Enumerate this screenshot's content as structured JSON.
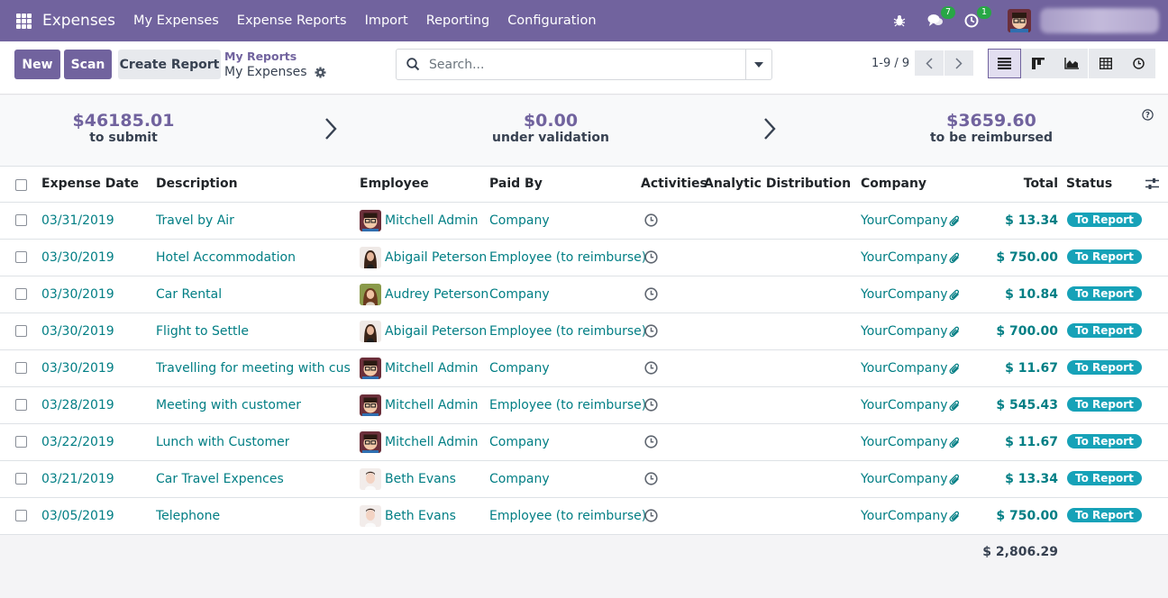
{
  "nav": {
    "app_name": "Expenses",
    "menu": [
      "My Expenses",
      "Expense Reports",
      "Import",
      "Reporting",
      "Configuration"
    ],
    "messages_count": "7",
    "activities_count": "1"
  },
  "control": {
    "new_label": "New",
    "scan_label": "Scan",
    "create_report_label": "Create Report",
    "breadcrumb_parent": "My Reports",
    "breadcrumb_current": "My Expenses",
    "search_placeholder": "Search...",
    "pager": "1-9 / 9"
  },
  "summary": {
    "to_submit_amount": "$46185.01",
    "to_submit_label": "to submit",
    "validation_amount": "$0.00",
    "validation_label": "under validation",
    "reimbursed_amount": "$3659.60",
    "reimbursed_label": "to be reimbursed"
  },
  "table": {
    "columns": {
      "date": "Expense Date",
      "description": "Description",
      "employee": "Employee",
      "paid_by": "Paid By",
      "activities": "Activities",
      "analytic": "Analytic Distribution",
      "company": "Company",
      "total": "Total",
      "status": "Status"
    },
    "rows": [
      {
        "date": "03/31/2019",
        "description": "Travel by Air",
        "employee": "Mitchell Admin",
        "avatar": "mitchell",
        "paid_by": "Company",
        "company": "YourCompany",
        "total": "$ 13.34",
        "status": "To Report"
      },
      {
        "date": "03/30/2019",
        "description": "Hotel Accommodation",
        "employee": "Abigail Peterson",
        "avatar": "abigail",
        "paid_by": "Employee (to reimburse)",
        "company": "YourCompany",
        "total": "$ 750.00",
        "status": "To Report"
      },
      {
        "date": "03/30/2019",
        "description": "Car Rental",
        "employee": "Audrey Peterson",
        "avatar": "audrey",
        "paid_by": "Company",
        "company": "YourCompany",
        "total": "$ 10.84",
        "status": "To Report"
      },
      {
        "date": "03/30/2019",
        "description": "Flight to Settle",
        "employee": "Abigail Peterson",
        "avatar": "abigail",
        "paid_by": "Employee (to reimburse)",
        "company": "YourCompany",
        "total": "$ 700.00",
        "status": "To Report"
      },
      {
        "date": "03/30/2019",
        "description": "Travelling for meeting with cust…",
        "employee": "Mitchell Admin",
        "avatar": "mitchell",
        "paid_by": "Company",
        "company": "YourCompany",
        "total": "$ 11.67",
        "status": "To Report"
      },
      {
        "date": "03/28/2019",
        "description": "Meeting with customer",
        "employee": "Mitchell Admin",
        "avatar": "mitchell",
        "paid_by": "Employee (to reimburse)",
        "company": "YourCompany",
        "total": "$ 545.43",
        "status": "To Report"
      },
      {
        "date": "03/22/2019",
        "description": "Lunch with Customer",
        "employee": "Mitchell Admin",
        "avatar": "mitchell",
        "paid_by": "Company",
        "company": "YourCompany",
        "total": "$ 11.67",
        "status": "To Report"
      },
      {
        "date": "03/21/2019",
        "description": "Car Travel Expences",
        "employee": "Beth Evans",
        "avatar": "beth",
        "paid_by": "Company",
        "company": "YourCompany",
        "total": "$ 13.34",
        "status": "To Report"
      },
      {
        "date": "03/05/2019",
        "description": "Telephone",
        "employee": "Beth Evans",
        "avatar": "beth",
        "paid_by": "Employee (to reimburse)",
        "company": "YourCompany",
        "total": "$ 750.00",
        "status": "To Report"
      }
    ],
    "grand_total": "$ 2,806.29"
  },
  "colors": {
    "brand": "#71639e",
    "link": "#017e84",
    "badge": "#17a2b8"
  }
}
